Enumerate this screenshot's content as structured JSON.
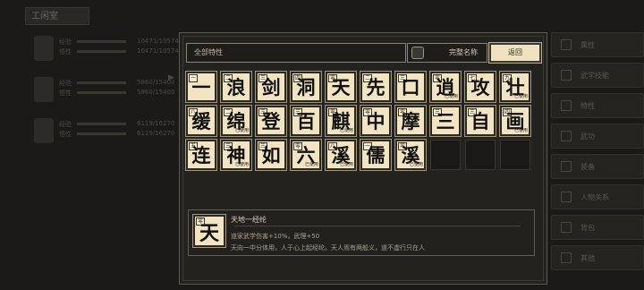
{
  "background": {
    "header": "工闲室",
    "characters": [
      {
        "stat1_label": "经验",
        "stat2_label": "悟性",
        "num1": "10471/10574",
        "num2": "10471/10574"
      },
      {
        "stat1_label": "经验",
        "stat2_label": "悟性",
        "num1": "5860/15400",
        "num2": "5860/15400"
      },
      {
        "stat1_label": "经验",
        "stat2_label": "悟性",
        "num1": "6119/16270",
        "num2": "6119/16270"
      }
    ],
    "side_buttons": [
      "属性",
      "武学技能",
      "特性",
      "武功",
      "装备",
      "人物关系",
      "背包",
      "其他"
    ]
  },
  "dialog": {
    "filter_text": "全部特性",
    "checkbox_label": "完整名称",
    "back_label": "返回"
  },
  "tiles": [
    {
      "ch": "一",
      "lv": "一",
      "stamp": ""
    },
    {
      "ch": "浪",
      "lv": "二",
      "stamp": ""
    },
    {
      "ch": "剑",
      "lv": "三",
      "stamp": ""
    },
    {
      "ch": "洞",
      "lv": "四",
      "stamp": ""
    },
    {
      "ch": "天",
      "lv": "零",
      "stamp": ""
    },
    {
      "ch": "先",
      "lv": "二",
      "stamp": ""
    },
    {
      "ch": "口",
      "lv": "三",
      "stamp": ""
    },
    {
      "ch": "逍",
      "lv": "零",
      "stamp": "已使用"
    },
    {
      "ch": "攻",
      "lv": "七",
      "stamp": ""
    },
    {
      "ch": "壮",
      "lv": "九",
      "stamp": "已使用"
    },
    {
      "ch": "缓",
      "lv": "八",
      "stamp": ""
    },
    {
      "ch": "绵",
      "lv": "二",
      "stamp": "已使用"
    },
    {
      "ch": "登",
      "lv": "三",
      "stamp": ""
    },
    {
      "ch": "百",
      "lv": "三",
      "stamp": ""
    },
    {
      "ch": "麒",
      "lv": "零",
      "stamp": "已使用"
    },
    {
      "ch": "中",
      "lv": "零",
      "stamp": ""
    },
    {
      "ch": "摩",
      "lv": "零",
      "stamp": ""
    },
    {
      "ch": "三",
      "lv": "三",
      "stamp": ""
    },
    {
      "ch": "自",
      "lv": "三",
      "stamp": ""
    },
    {
      "ch": "画",
      "lv": "四",
      "stamp": "已使用"
    },
    {
      "ch": "连",
      "lv": "五",
      "stamp": ""
    },
    {
      "ch": "神",
      "lv": "三",
      "stamp": "已使用"
    },
    {
      "ch": "如",
      "lv": "三",
      "stamp": ""
    },
    {
      "ch": "六",
      "lv": "零",
      "stamp": "已使用"
    },
    {
      "ch": "溪",
      "lv": "八",
      "stamp": "已使用"
    },
    {
      "ch": "儒",
      "lv": "一",
      "stamp": ""
    },
    {
      "ch": "溪",
      "lv": "零",
      "stamp": "已使用"
    }
  ],
  "selected": {
    "ch": "天",
    "lv": "零",
    "name": "天地一经纶",
    "effect": "道家武学伤害+10%，武理+50",
    "desc": "天向一中分体用，人于心上起经纶。天人焉有两般义，道不虚行只在人"
  }
}
